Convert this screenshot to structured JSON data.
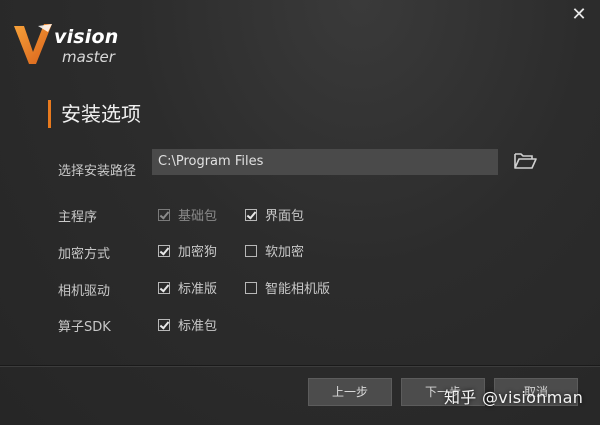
{
  "window": {
    "close_glyph": "✕"
  },
  "logo": {
    "line1": "vision",
    "line2": "master"
  },
  "section": {
    "title": "安装选项"
  },
  "install_path": {
    "label": "选择安装路径",
    "value": "C:\\Program Files",
    "browse_icon": "folder-open-icon"
  },
  "options": [
    {
      "label": "主程序",
      "choices": [
        {
          "label": "基础包",
          "checked": true,
          "disabled": true
        },
        {
          "label": "界面包",
          "checked": true,
          "disabled": false
        }
      ]
    },
    {
      "label": "加密方式",
      "choices": [
        {
          "label": "加密狗",
          "checked": true,
          "disabled": false
        },
        {
          "label": "软加密",
          "checked": false,
          "disabled": false
        }
      ]
    },
    {
      "label": "相机驱动",
      "choices": [
        {
          "label": "标准版",
          "checked": true,
          "disabled": false
        },
        {
          "label": "智能相机版",
          "checked": false,
          "disabled": false
        }
      ]
    },
    {
      "label": "算子SDK",
      "choices": [
        {
          "label": "标准包",
          "checked": true,
          "disabled": false
        }
      ]
    }
  ],
  "footer": {
    "prev_label": "上一步",
    "next_label": "下一步",
    "cancel_label": "取消",
    "watermark": "知乎 @visionman"
  },
  "colors": {
    "accent": "#e87a1e",
    "background": "#2c2c2c",
    "input_bg": "#4a4a4a"
  }
}
